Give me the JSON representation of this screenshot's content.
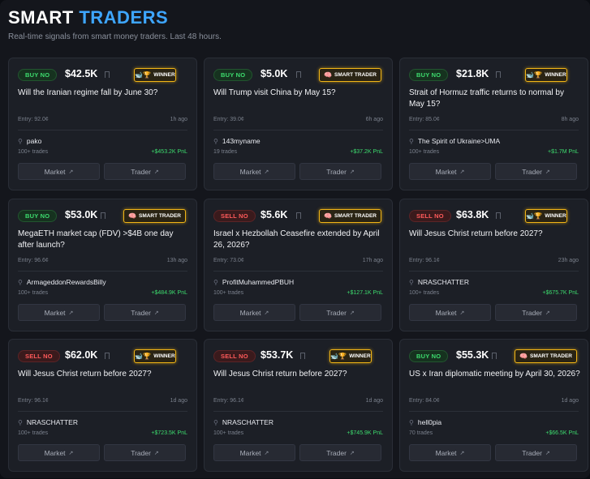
{
  "header": {
    "title_part1": "SMART",
    "title_part2": "TRADERS",
    "subtitle": "Real-time signals from smart money traders. Last 48 hours."
  },
  "colors": {
    "accent": "#3ea6ff",
    "buy": "#3ddc6e",
    "sell": "#ff5a5a",
    "badge_border": "#f2b516"
  },
  "icons": {
    "bookmark": "bookmark-icon",
    "user": "user-icon",
    "external": "external-link-icon",
    "winner": "trophy-icon",
    "smart": "brain-icon"
  },
  "cards": [
    {
      "side": "BUY NO",
      "side_type": "buy",
      "amount": "$42.5K",
      "badge": "WINNER",
      "badge_type": "winner",
      "question": "Will the Iranian regime fall by June 30?",
      "entry": "Entry: 92.0¢",
      "ago": "1h ago",
      "user": "pako",
      "trades": "100+ trades",
      "pnl": "+$453.2K PnL",
      "market_label": "Market",
      "trader_label": "Trader"
    },
    {
      "side": "BUY NO",
      "side_type": "buy",
      "amount": "$5.0K",
      "badge": "SMART TRADER",
      "badge_type": "smart",
      "question": "Will Trump visit China by May 15?",
      "entry": "Entry: 39.0¢",
      "ago": "6h ago",
      "user": "143myname",
      "trades": "19 trades",
      "pnl": "+$37.2K PnL",
      "market_label": "Market",
      "trader_label": "Trader"
    },
    {
      "side": "BUY NO",
      "side_type": "buy",
      "amount": "$21.8K",
      "badge": "WINNER",
      "badge_type": "winner",
      "question": "Strait of Hormuz traffic returns to normal by May 15?",
      "entry": "Entry: 85.0¢",
      "ago": "8h ago",
      "user": "The Spirit of Ukraine>UMA",
      "trades": "100+ trades",
      "pnl": "+$1.7M PnL",
      "market_label": "Market",
      "trader_label": "Trader"
    },
    {
      "side": "BUY NO",
      "side_type": "buy",
      "amount": "$53.0K",
      "badge": "SMART TRADER",
      "badge_type": "smart",
      "question": "MegaETH market cap (FDV) >$4B one day after launch?",
      "entry": "Entry: 96.6¢",
      "ago": "13h ago",
      "user": "ArmageddonRewardsBilly",
      "trades": "100+ trades",
      "pnl": "+$484.9K PnL",
      "market_label": "Market",
      "trader_label": "Trader"
    },
    {
      "side": "SELL NO",
      "side_type": "sell",
      "amount": "$5.6K",
      "badge": "SMART TRADER",
      "badge_type": "smart",
      "question": "Israel x Hezbollah Ceasefire extended by April 26, 2026?",
      "entry": "Entry: 73.0¢",
      "ago": "17h ago",
      "user": "ProfitMuhammedPBUH",
      "trades": "100+ trades",
      "pnl": "+$127.1K PnL",
      "market_label": "Market",
      "trader_label": "Trader"
    },
    {
      "side": "SELL NO",
      "side_type": "sell",
      "amount": "$63.8K",
      "badge": "WINNER",
      "badge_type": "winner",
      "question": "Will Jesus Christ return before 2027?",
      "entry": "Entry: 96.1¢",
      "ago": "23h ago",
      "user": "NRASCHATTER",
      "trades": "100+ trades",
      "pnl": "+$675.7K PnL",
      "market_label": "Market",
      "trader_label": "Trader"
    },
    {
      "side": "SELL NO",
      "side_type": "sell",
      "amount": "$62.0K",
      "badge": "WINNER",
      "badge_type": "winner",
      "question": "Will Jesus Christ return before 2027?",
      "entry": "Entry: 96.1¢",
      "ago": "1d ago",
      "user": "NRASCHATTER",
      "trades": "100+ trades",
      "pnl": "+$723.5K PnL",
      "market_label": "Market",
      "trader_label": "Trader"
    },
    {
      "side": "SELL NO",
      "side_type": "sell",
      "amount": "$53.7K",
      "badge": "WINNER",
      "badge_type": "winner",
      "question": "Will Jesus Christ return before 2027?",
      "entry": "Entry: 96.1¢",
      "ago": "1d ago",
      "user": "NRASCHATTER",
      "trades": "100+ trades",
      "pnl": "+$745.9K PnL",
      "market_label": "Market",
      "trader_label": "Trader"
    },
    {
      "side": "BUY NO",
      "side_type": "buy",
      "amount": "$55.3K",
      "badge": "SMART TRADER",
      "badge_type": "smart",
      "question": "US x Iran diplomatic meeting by April 30, 2026?",
      "entry": "Entry: 84.0¢",
      "ago": "1d ago",
      "user": "hell0pia",
      "trades": "70 trades",
      "pnl": "+$66.5K PnL",
      "market_label": "Market",
      "trader_label": "Trader"
    }
  ]
}
